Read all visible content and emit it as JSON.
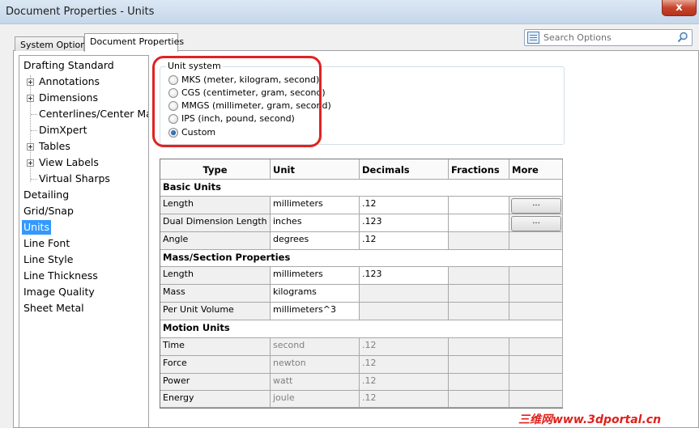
{
  "window": {
    "title": "Document Properties - Units",
    "close_glyph": "x"
  },
  "tabs": [
    {
      "label": "System Options"
    },
    {
      "label": "Document Properties"
    }
  ],
  "search": {
    "placeholder": "Search Options"
  },
  "tree": {
    "items": [
      {
        "label": "Drafting Standard"
      },
      {
        "label": "Annotations"
      },
      {
        "label": "Dimensions"
      },
      {
        "label": "Centerlines/Center Mar"
      },
      {
        "label": "DimXpert"
      },
      {
        "label": "Tables"
      },
      {
        "label": "View Labels"
      },
      {
        "label": "Virtual Sharps"
      },
      {
        "label": "Detailing"
      },
      {
        "label": "Grid/Snap"
      },
      {
        "label": "Units"
      },
      {
        "label": "Line Font"
      },
      {
        "label": "Line Style"
      },
      {
        "label": "Line Thickness"
      },
      {
        "label": "Image Quality"
      },
      {
        "label": "Sheet Metal"
      }
    ],
    "selected": "Units"
  },
  "unit_system": {
    "legend": "Unit system",
    "options": [
      {
        "label": "MKS  (meter, kilogram, second)",
        "checked": false
      },
      {
        "label": "CGS  (centimeter, gram, second)",
        "checked": false
      },
      {
        "label": "MMGS (millimeter, gram, second)",
        "checked": false
      },
      {
        "label": "IPS  (inch, pound, second)",
        "checked": false
      },
      {
        "label": "Custom",
        "checked": true
      }
    ]
  },
  "grid": {
    "headers": [
      "Type",
      "Unit",
      "Decimals",
      "Fractions",
      "More"
    ],
    "sections": [
      {
        "title": "Basic Units"
      },
      {
        "title": "Mass/Section Properties"
      },
      {
        "title": "Motion Units"
      }
    ],
    "rows": [
      {
        "type": "Length",
        "unit": "millimeters",
        "decimals": ".12",
        "more": "..."
      },
      {
        "type": "Dual Dimension Length",
        "unit": "inches",
        "decimals": ".123",
        "more": "..."
      },
      {
        "type": "Angle",
        "unit": "degrees",
        "decimals": ".12"
      },
      {
        "type": "Length",
        "unit": "millimeters",
        "decimals": ".123"
      },
      {
        "type": "Mass",
        "unit": "kilograms",
        "decimals": ""
      },
      {
        "type": "Per Unit Volume",
        "unit": "millimeters^3",
        "decimals": ""
      },
      {
        "type": "Time",
        "unit": "second",
        "decimals": ".12"
      },
      {
        "type": "Force",
        "unit": "newton",
        "decimals": ".12"
      },
      {
        "type": "Power",
        "unit": "watt",
        "decimals": ".12"
      },
      {
        "type": "Energy",
        "unit": "joule",
        "decimals": ".12"
      }
    ]
  },
  "watermark": "三维网www.3dportal.cn",
  "colors": {
    "selection": "#3399ff",
    "highlight": "#e02222"
  }
}
